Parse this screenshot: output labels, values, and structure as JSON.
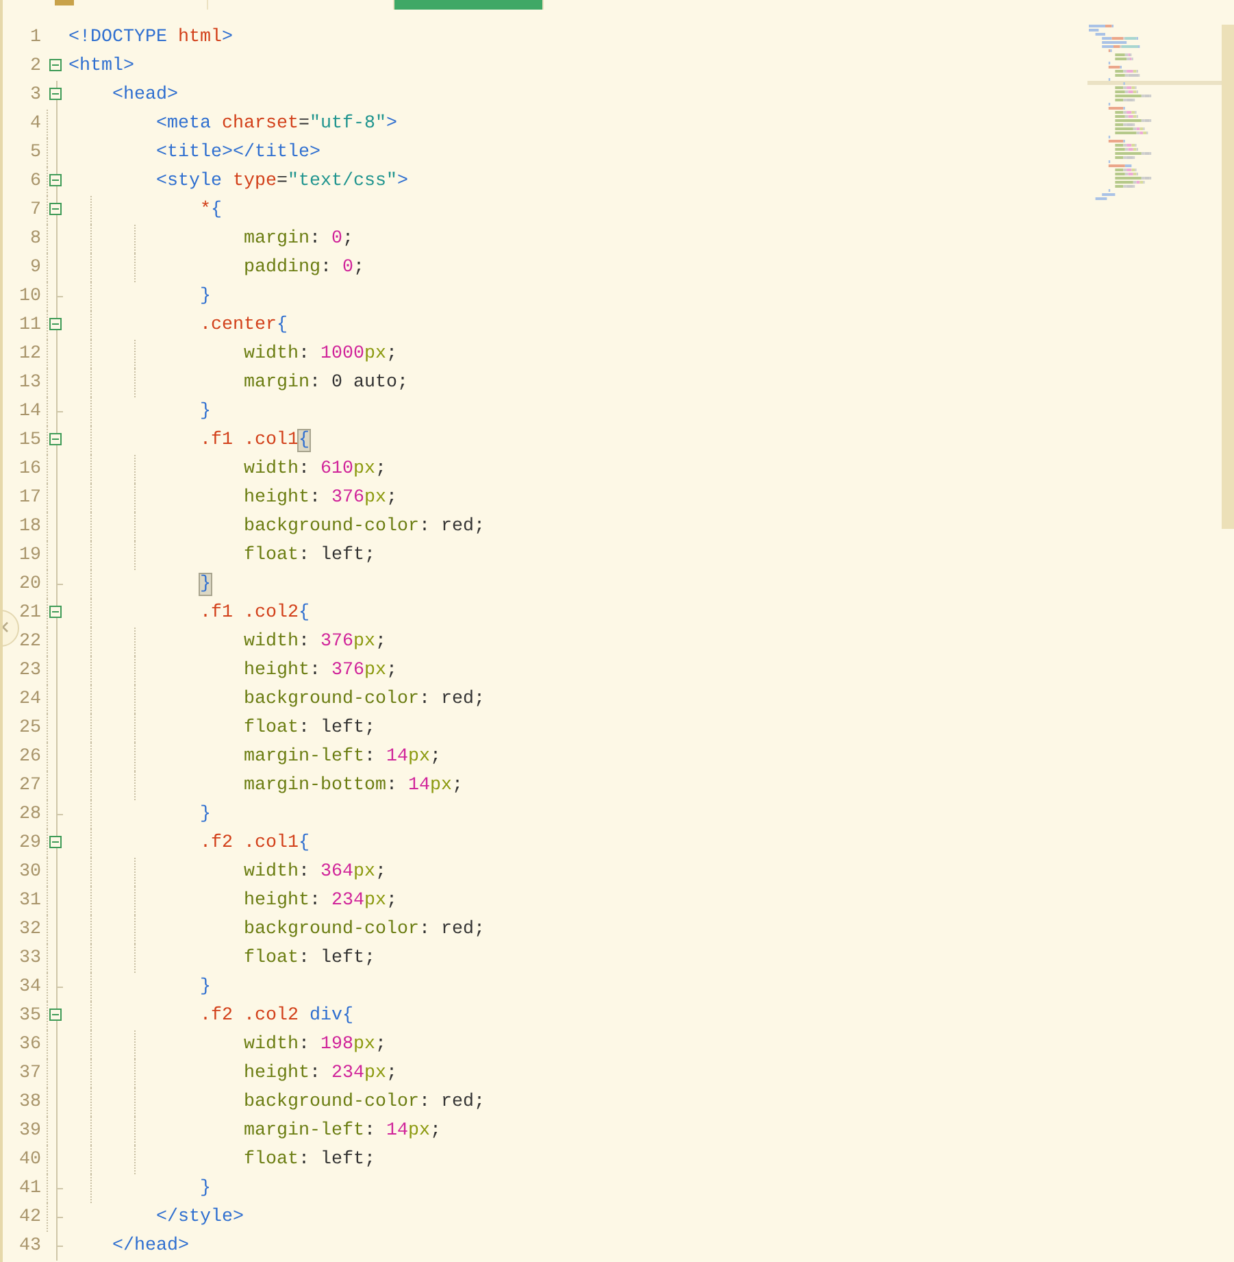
{
  "tabs": [
    {
      "selected": false
    },
    {
      "selected": false
    },
    {
      "selected": true
    }
  ],
  "lines": [
    {
      "number": "1",
      "kind": "plain",
      "tokens": [
        {
          "kind": "tag",
          "text": "<!DOCTYPE "
        },
        {
          "kind": "attr",
          "text": "html"
        },
        {
          "kind": "tag",
          "text": ">"
        }
      ]
    },
    {
      "number": "2",
      "kind": "fold-start",
      "tokens": [
        {
          "kind": "tag",
          "text": "<html>"
        }
      ]
    },
    {
      "number": "3",
      "kind": "fold-start",
      "tokens": [
        {
          "kind": "tag",
          "text": "    <head>"
        }
      ]
    },
    {
      "number": "4",
      "kind": "plain",
      "tokens": [
        {
          "kind": "tag",
          "text": "        <meta "
        },
        {
          "kind": "attr",
          "text": "charset"
        },
        {
          "kind": "punct",
          "text": "="
        },
        {
          "kind": "string",
          "text": "\"utf-8\""
        },
        {
          "kind": "tag",
          "text": ">"
        }
      ]
    },
    {
      "number": "5",
      "kind": "plain",
      "tokens": [
        {
          "kind": "tag",
          "text": "        <title></title>"
        }
      ]
    },
    {
      "number": "6",
      "kind": "fold-start",
      "tokens": [
        {
          "kind": "tag",
          "text": "        <style "
        },
        {
          "kind": "attr",
          "text": "type"
        },
        {
          "kind": "punct",
          "text": "="
        },
        {
          "kind": "string",
          "text": "\"text/css\""
        },
        {
          "kind": "tag",
          "text": ">"
        }
      ]
    },
    {
      "number": "7",
      "kind": "fold-start",
      "tokens": [
        {
          "kind": "selector",
          "text": "            *"
        },
        {
          "kind": "brace",
          "text": "{",
          "matched": false
        }
      ]
    },
    {
      "number": "8",
      "kind": "plain",
      "tokens": [
        {
          "kind": "prop",
          "text": "                margin"
        },
        {
          "kind": "punct",
          "text": ": "
        },
        {
          "kind": "num",
          "text": "0"
        },
        {
          "kind": "punct",
          "text": ";"
        }
      ]
    },
    {
      "number": "9",
      "kind": "plain",
      "tokens": [
        {
          "kind": "prop",
          "text": "                padding"
        },
        {
          "kind": "punct",
          "text": ": "
        },
        {
          "kind": "num",
          "text": "0"
        },
        {
          "kind": "punct",
          "text": ";"
        }
      ]
    },
    {
      "number": "10",
      "kind": "fold-end",
      "tokens": [
        {
          "kind": "brace",
          "text": "            }",
          "matched": false
        }
      ]
    },
    {
      "number": "11",
      "kind": "fold-start",
      "tokens": [
        {
          "kind": "selector",
          "text": "            .center"
        },
        {
          "kind": "brace",
          "text": "{",
          "matched": false
        }
      ]
    },
    {
      "number": "12",
      "kind": "plain",
      "tokens": [
        {
          "kind": "prop",
          "text": "                width"
        },
        {
          "kind": "punct",
          "text": ": "
        },
        {
          "kind": "num",
          "text": "1000"
        },
        {
          "kind": "unit",
          "text": "px"
        },
        {
          "kind": "punct",
          "text": ";"
        }
      ]
    },
    {
      "number": "13",
      "kind": "plain",
      "tokens": [
        {
          "kind": "prop",
          "text": "                margin"
        },
        {
          "kind": "punct",
          "text": ": "
        },
        {
          "kind": "value",
          "text": "0 auto"
        },
        {
          "kind": "punct",
          "text": ";"
        }
      ]
    },
    {
      "number": "14",
      "kind": "fold-end",
      "tokens": [
        {
          "kind": "brace",
          "text": "            }",
          "matched": false
        }
      ]
    },
    {
      "number": "15",
      "kind": "fold-start",
      "tokens": [
        {
          "kind": "selector",
          "text": "            .f1 .col1"
        },
        {
          "kind": "brace",
          "text": "{",
          "matched": true
        }
      ]
    },
    {
      "number": "16",
      "kind": "plain",
      "tokens": [
        {
          "kind": "prop",
          "text": "                width"
        },
        {
          "kind": "punct",
          "text": ": "
        },
        {
          "kind": "num",
          "text": "610"
        },
        {
          "kind": "unit",
          "text": "px"
        },
        {
          "kind": "punct",
          "text": ";"
        }
      ]
    },
    {
      "number": "17",
      "kind": "plain",
      "tokens": [
        {
          "kind": "prop",
          "text": "                height"
        },
        {
          "kind": "punct",
          "text": ": "
        },
        {
          "kind": "num",
          "text": "376"
        },
        {
          "kind": "unit",
          "text": "px"
        },
        {
          "kind": "punct",
          "text": ";"
        }
      ]
    },
    {
      "number": "18",
      "kind": "plain",
      "tokens": [
        {
          "kind": "prop",
          "text": "                background-color"
        },
        {
          "kind": "punct",
          "text": ": "
        },
        {
          "kind": "value",
          "text": "red"
        },
        {
          "kind": "punct",
          "text": ";"
        }
      ]
    },
    {
      "number": "19",
      "kind": "plain",
      "tokens": [
        {
          "kind": "prop",
          "text": "                float"
        },
        {
          "kind": "punct",
          "text": ": "
        },
        {
          "kind": "value",
          "text": "left"
        },
        {
          "kind": "punct",
          "text": ";"
        }
      ]
    },
    {
      "number": "20",
      "kind": "fold-end",
      "tokens": [
        {
          "kind": "brace",
          "text": "            }",
          "matched": true
        }
      ]
    },
    {
      "number": "21",
      "kind": "fold-start",
      "tokens": [
        {
          "kind": "selector",
          "text": "            .f1 .col2"
        },
        {
          "kind": "brace",
          "text": "{",
          "matched": false
        }
      ]
    },
    {
      "number": "22",
      "kind": "plain",
      "tokens": [
        {
          "kind": "prop",
          "text": "                width"
        },
        {
          "kind": "punct",
          "text": ": "
        },
        {
          "kind": "num",
          "text": "376"
        },
        {
          "kind": "unit",
          "text": "px"
        },
        {
          "kind": "punct",
          "text": ";"
        }
      ]
    },
    {
      "number": "23",
      "kind": "plain",
      "tokens": [
        {
          "kind": "prop",
          "text": "                height"
        },
        {
          "kind": "punct",
          "text": ": "
        },
        {
          "kind": "num",
          "text": "376"
        },
        {
          "kind": "unit",
          "text": "px"
        },
        {
          "kind": "punct",
          "text": ";"
        }
      ]
    },
    {
      "number": "24",
      "kind": "plain",
      "tokens": [
        {
          "kind": "prop",
          "text": "                background-color"
        },
        {
          "kind": "punct",
          "text": ": "
        },
        {
          "kind": "value",
          "text": "red"
        },
        {
          "kind": "punct",
          "text": ";"
        }
      ]
    },
    {
      "number": "25",
      "kind": "plain",
      "tokens": [
        {
          "kind": "prop",
          "text": "                float"
        },
        {
          "kind": "punct",
          "text": ": "
        },
        {
          "kind": "value",
          "text": "left"
        },
        {
          "kind": "punct",
          "text": ";"
        }
      ]
    },
    {
      "number": "26",
      "kind": "plain",
      "tokens": [
        {
          "kind": "prop",
          "text": "                margin-left"
        },
        {
          "kind": "punct",
          "text": ": "
        },
        {
          "kind": "num",
          "text": "14"
        },
        {
          "kind": "unit",
          "text": "px"
        },
        {
          "kind": "punct",
          "text": ";"
        }
      ]
    },
    {
      "number": "27",
      "kind": "plain",
      "tokens": [
        {
          "kind": "prop",
          "text": "                margin-bottom"
        },
        {
          "kind": "punct",
          "text": ": "
        },
        {
          "kind": "num",
          "text": "14"
        },
        {
          "kind": "unit",
          "text": "px"
        },
        {
          "kind": "punct",
          "text": ";"
        }
      ]
    },
    {
      "number": "28",
      "kind": "fold-end",
      "tokens": [
        {
          "kind": "brace",
          "text": "            }",
          "matched": false
        }
      ]
    },
    {
      "number": "29",
      "kind": "fold-start",
      "tokens": [
        {
          "kind": "selector",
          "text": "            .f2 .col1"
        },
        {
          "kind": "brace",
          "text": "{",
          "matched": false
        }
      ]
    },
    {
      "number": "30",
      "kind": "plain",
      "tokens": [
        {
          "kind": "prop",
          "text": "                width"
        },
        {
          "kind": "punct",
          "text": ": "
        },
        {
          "kind": "num",
          "text": "364"
        },
        {
          "kind": "unit",
          "text": "px"
        },
        {
          "kind": "punct",
          "text": ";"
        }
      ]
    },
    {
      "number": "31",
      "kind": "plain",
      "tokens": [
        {
          "kind": "prop",
          "text": "                height"
        },
        {
          "kind": "punct",
          "text": ": "
        },
        {
          "kind": "num",
          "text": "234"
        },
        {
          "kind": "unit",
          "text": "px"
        },
        {
          "kind": "punct",
          "text": ";"
        }
      ]
    },
    {
      "number": "32",
      "kind": "plain",
      "tokens": [
        {
          "kind": "prop",
          "text": "                background-color"
        },
        {
          "kind": "punct",
          "text": ": "
        },
        {
          "kind": "value",
          "text": "red"
        },
        {
          "kind": "punct",
          "text": ";"
        }
      ]
    },
    {
      "number": "33",
      "kind": "plain",
      "tokens": [
        {
          "kind": "prop",
          "text": "                float"
        },
        {
          "kind": "punct",
          "text": ": "
        },
        {
          "kind": "value",
          "text": "left"
        },
        {
          "kind": "punct",
          "text": ";"
        }
      ]
    },
    {
      "number": "34",
      "kind": "fold-end",
      "tokens": [
        {
          "kind": "brace",
          "text": "            }",
          "matched": false
        }
      ]
    },
    {
      "number": "35",
      "kind": "fold-start",
      "tokens": [
        {
          "kind": "selector",
          "text": "            .f2 .col2 "
        },
        {
          "kind": "tag",
          "text": "div"
        },
        {
          "kind": "brace",
          "text": "{",
          "matched": false
        }
      ]
    },
    {
      "number": "36",
      "kind": "plain",
      "tokens": [
        {
          "kind": "prop",
          "text": "                width"
        },
        {
          "kind": "punct",
          "text": ": "
        },
        {
          "kind": "num",
          "text": "198"
        },
        {
          "kind": "unit",
          "text": "px"
        },
        {
          "kind": "punct",
          "text": ";"
        }
      ]
    },
    {
      "number": "37",
      "kind": "plain",
      "tokens": [
        {
          "kind": "prop",
          "text": "                height"
        },
        {
          "kind": "punct",
          "text": ": "
        },
        {
          "kind": "num",
          "text": "234"
        },
        {
          "kind": "unit",
          "text": "px"
        },
        {
          "kind": "punct",
          "text": ";"
        }
      ]
    },
    {
      "number": "38",
      "kind": "plain",
      "tokens": [
        {
          "kind": "prop",
          "text": "                background-color"
        },
        {
          "kind": "punct",
          "text": ": "
        },
        {
          "kind": "value",
          "text": "red"
        },
        {
          "kind": "punct",
          "text": ";"
        }
      ]
    },
    {
      "number": "39",
      "kind": "plain",
      "tokens": [
        {
          "kind": "prop",
          "text": "                margin-left"
        },
        {
          "kind": "punct",
          "text": ": "
        },
        {
          "kind": "num",
          "text": "14"
        },
        {
          "kind": "unit",
          "text": "px"
        },
        {
          "kind": "punct",
          "text": ";"
        }
      ]
    },
    {
      "number": "40",
      "kind": "plain",
      "tokens": [
        {
          "kind": "prop",
          "text": "                float"
        },
        {
          "kind": "punct",
          "text": ": "
        },
        {
          "kind": "value",
          "text": "left"
        },
        {
          "kind": "punct",
          "text": ";"
        }
      ]
    },
    {
      "number": "41",
      "kind": "fold-end",
      "tokens": [
        {
          "kind": "brace",
          "text": "            }",
          "matched": false
        }
      ]
    },
    {
      "number": "42",
      "kind": "fold-end",
      "tokens": [
        {
          "kind": "tag",
          "text": "        </style>"
        }
      ]
    },
    {
      "number": "43",
      "kind": "fold-end",
      "tokens": [
        {
          "kind": "tag",
          "text": "    </head>"
        }
      ]
    }
  ]
}
